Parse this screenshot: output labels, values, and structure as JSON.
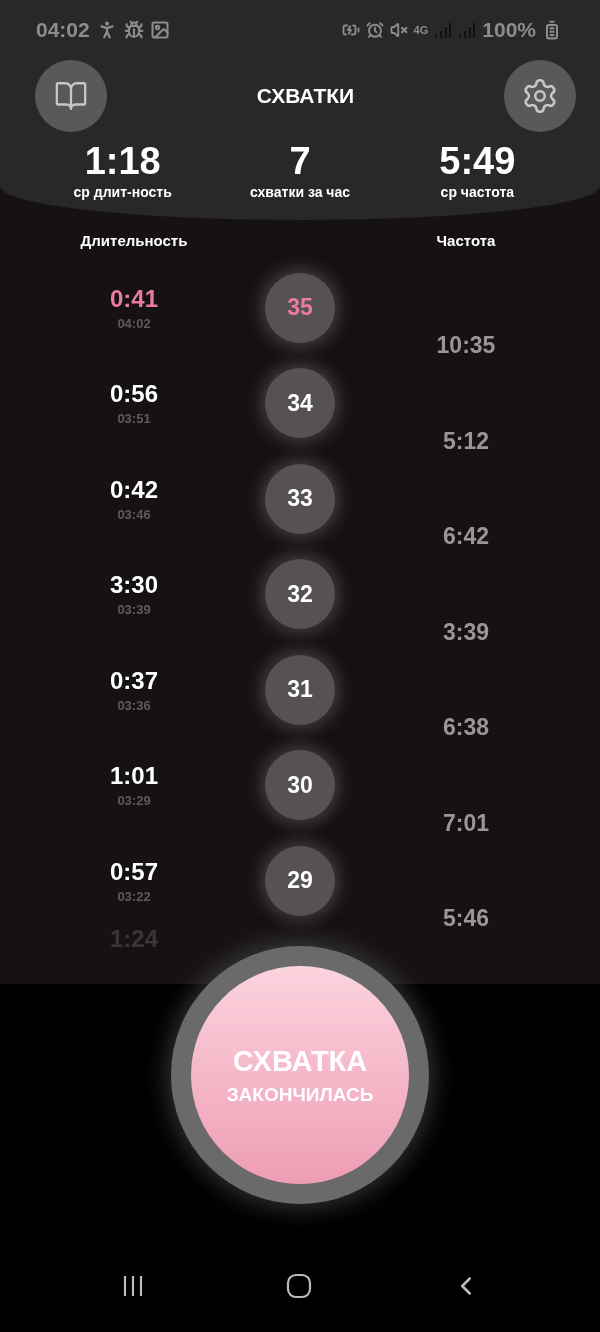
{
  "status_bar": {
    "time": "04:02",
    "network": "4G",
    "battery": "100%"
  },
  "header": {
    "title": "СХВАТКИ"
  },
  "stats": [
    {
      "value": "1:18",
      "label": "ср длит-ность"
    },
    {
      "value": "7",
      "label": "схватки за час"
    },
    {
      "value": "5:49",
      "label": "ср частота"
    }
  ],
  "columns": {
    "duration": "Длительность",
    "frequency": "Частота"
  },
  "contractions": [
    {
      "number": "35",
      "duration": "0:41",
      "time": "04:02",
      "frequency": "10:35",
      "current": true
    },
    {
      "number": "34",
      "duration": "0:56",
      "time": "03:51",
      "frequency": "5:12",
      "current": false
    },
    {
      "number": "33",
      "duration": "0:42",
      "time": "03:46",
      "frequency": "6:42",
      "current": false
    },
    {
      "number": "32",
      "duration": "3:30",
      "time": "03:39",
      "frequency": "3:39",
      "current": false
    },
    {
      "number": "31",
      "duration": "0:37",
      "time": "03:36",
      "frequency": "6:38",
      "current": false
    },
    {
      "number": "30",
      "duration": "1:01",
      "time": "03:29",
      "frequency": "7:01",
      "current": false
    },
    {
      "number": "29",
      "duration": "0:57",
      "time": "03:22",
      "frequency": "5:46",
      "current": false
    }
  ],
  "partial_row": {
    "duration": "1:24"
  },
  "action_button": {
    "line_1": "СХВАТКА",
    "line_2": "ЗАКОНЧИЛАСЬ"
  }
}
